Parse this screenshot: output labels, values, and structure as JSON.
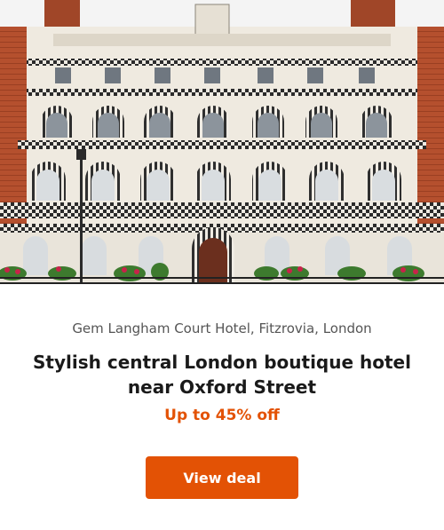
{
  "card": {
    "image_alt": "Hotel facade",
    "location": "Gem Langham Court Hotel, Fitzrovia, London",
    "title": "Stylish central London boutique hotel near Oxford Street",
    "discount": "Up to 45% off",
    "cta_label": "View deal"
  },
  "colors": {
    "accent": "#e35205",
    "discount_text": "#e35205",
    "facade": "#efeae0",
    "brick": "#b5502e",
    "sky": "#f4f4f4"
  }
}
